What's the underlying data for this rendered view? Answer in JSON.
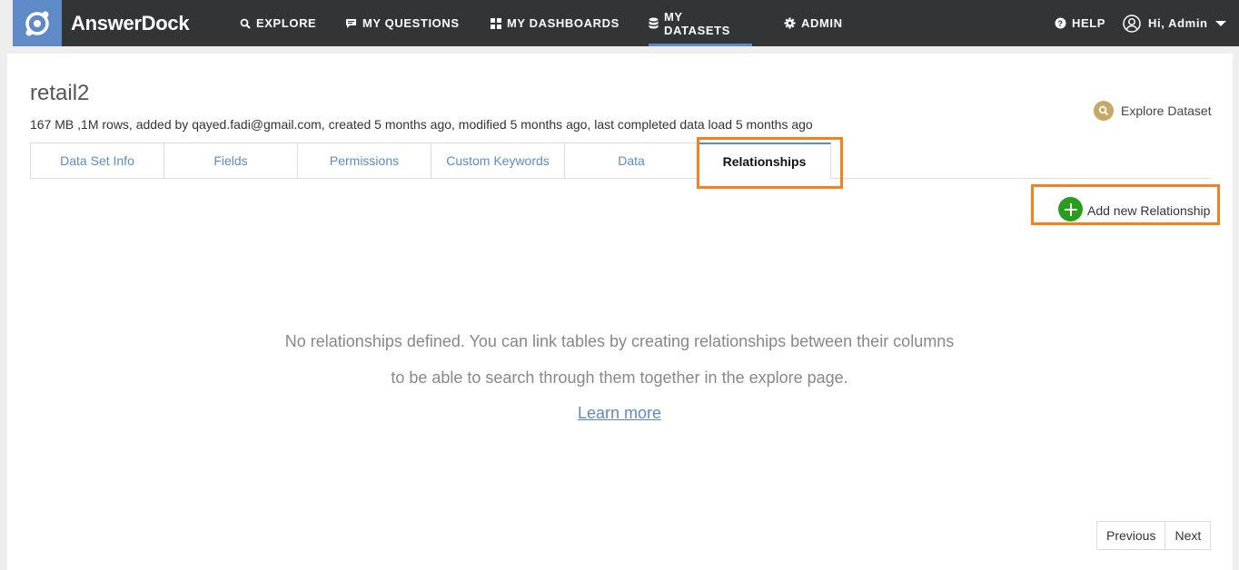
{
  "app": {
    "brand": "AnswerDock"
  },
  "nav": {
    "explore": "EXPLORE",
    "my_questions": "MY QUESTIONS",
    "my_dashboards": "MY DASHBOARDS",
    "my_datasets": "MY DATASETS",
    "admin": "ADMIN",
    "help": "HELP",
    "user_greeting": "Hi, Admin"
  },
  "dataset": {
    "title": "retail2",
    "meta": "167 MB ,1M rows, added by qayed.fadi@gmail.com, created 5 months ago, modified 5 months ago, last completed data load 5 months ago",
    "explore_label": "Explore Dataset"
  },
  "tabs": [
    {
      "label": "Data Set Info"
    },
    {
      "label": "Fields"
    },
    {
      "label": "Permissions"
    },
    {
      "label": "Custom Keywords"
    },
    {
      "label": "Data"
    },
    {
      "label": "Relationships",
      "active": true
    }
  ],
  "relationships": {
    "add_label": "Add new Relationship",
    "empty_line1": "No relationships defined. You can link tables by creating relationships between their columns",
    "empty_line2": "to be able to search through them together in the explore page.",
    "learn_more": "Learn more"
  },
  "pagination": {
    "previous": "Previous",
    "next": "Next"
  },
  "colors": {
    "nav_bg": "#333435",
    "accent": "#5e8ac8",
    "highlight": "#f48024",
    "add_green": "#2a9d1f",
    "explore_gold": "#c8a865"
  }
}
